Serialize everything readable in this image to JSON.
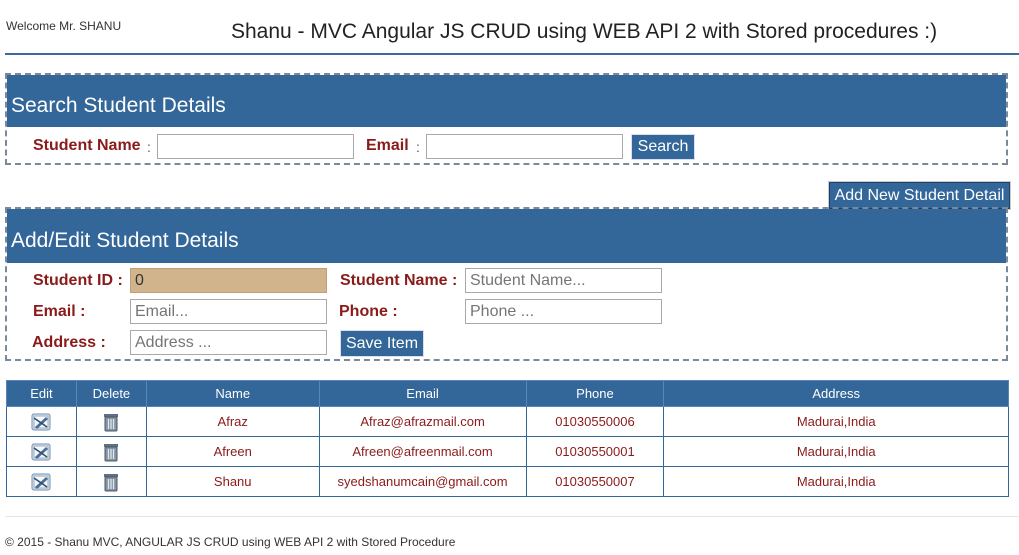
{
  "header": {
    "welcome": "Welcome Mr. SHANU",
    "title": "Shanu - MVC Angular JS CRUD using WEB API 2 with Stored procedures :)"
  },
  "search": {
    "heading": "Search Student Details",
    "name_label": "Student Name",
    "email_label": "Email",
    "colon": ":",
    "name_value": "",
    "email_value": "",
    "button": "Search"
  },
  "add_button": "Add New Student Detail",
  "edit": {
    "heading": "Add/Edit Student Details",
    "id_label": "Student ID :",
    "id_value": "0",
    "name_label": "Student Name :",
    "name_placeholder": "Student Name...",
    "email_label": "Email :",
    "email_placeholder": "Email...",
    "phone_label": "Phone :",
    "phone_placeholder": "Phone ...",
    "address_label": "Address :",
    "address_placeholder": "Address ...",
    "save_button": "Save Item"
  },
  "grid": {
    "columns": [
      "Edit",
      "Delete",
      "Name",
      "Email",
      "Phone",
      "Address"
    ],
    "rows": [
      {
        "name": "Afraz",
        "email": "Afraz@afrazmail.com",
        "phone": "01030550006",
        "address": "Madurai,India"
      },
      {
        "name": "Afreen",
        "email": "Afreen@afreenmail.com",
        "phone": "01030550001",
        "address": "Madurai,India"
      },
      {
        "name": "Shanu",
        "email": "syedshanumcain@gmail.com",
        "phone": "01030550007",
        "address": "Madurai,India"
      }
    ]
  },
  "footer": "© 2015 - Shanu MVC, ANGULAR JS CRUD using WEB API 2 with Stored Procedure"
}
